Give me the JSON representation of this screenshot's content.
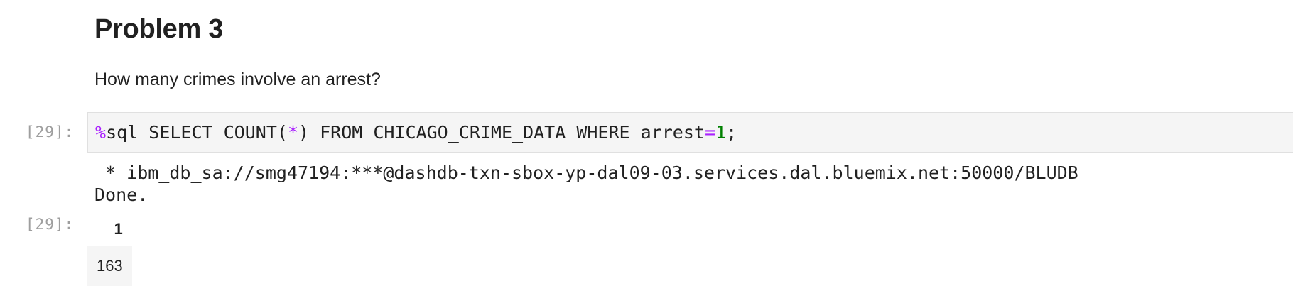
{
  "markdown": {
    "heading": "Problem 3",
    "question": "How many crimes involve an arrest?"
  },
  "input_cell": {
    "prompt": "[29]:",
    "code_magic": "%",
    "code_part1": "sql SELECT COUNT(",
    "code_star": "*",
    "code_part2": ") FROM CHICAGO_CRIME_DATA WHERE arrest",
    "code_eq": "=",
    "code_num": "1",
    "code_end": ";"
  },
  "output": {
    "stdout_line1": " * ibm_db_sa://smg47194:***@dashdb-txn-sbox-yp-dal09-03.services.dal.bluemix.net:50000/BLUDB",
    "stdout_line2": "Done.",
    "prompt": "[29]:",
    "table": {
      "columns": [
        "1"
      ],
      "rows": [
        [
          "163"
        ]
      ]
    }
  }
}
